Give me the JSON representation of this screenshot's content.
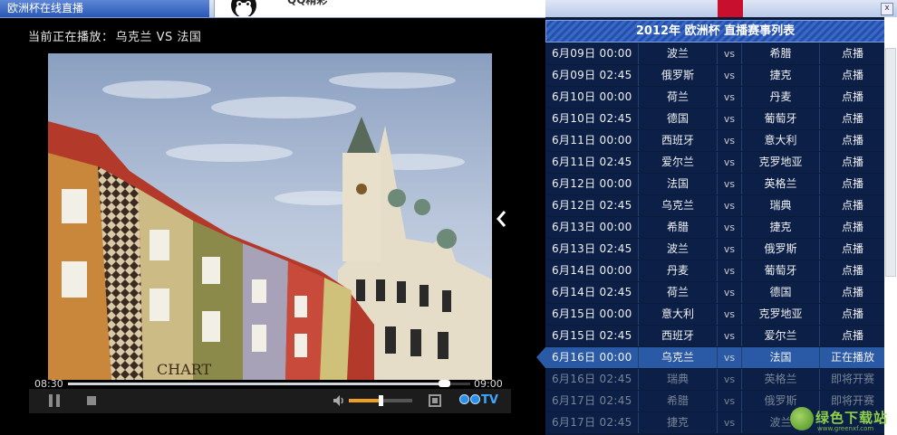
{
  "window": {
    "tab_title": "欧洲杯在线直播",
    "qq_label": "QQ精彩",
    "close_glyph": "x"
  },
  "player": {
    "now_playing_label": "当前正在播放：",
    "now_playing_match": "乌克兰 VS 法国",
    "current_time": "08:30",
    "total_time": "09:00",
    "progress_fraction": 0.935,
    "volume_fraction": 0.5,
    "logo_text": "TV"
  },
  "schedule": {
    "title": "2012年 欧洲杯 直播赛事列表",
    "vs_label": "vs",
    "rows": [
      {
        "date": "6月09日 00:00",
        "home": "波兰",
        "away": "希腊",
        "action": "点播",
        "state": "past"
      },
      {
        "date": "6月09日 02:45",
        "home": "俄罗斯",
        "away": "捷克",
        "action": "点播",
        "state": "past"
      },
      {
        "date": "6月10日 00:00",
        "home": "荷兰",
        "away": "丹麦",
        "action": "点播",
        "state": "past"
      },
      {
        "date": "6月10日 02:45",
        "home": "德国",
        "away": "葡萄牙",
        "action": "点播",
        "state": "past"
      },
      {
        "date": "6月11日 00:00",
        "home": "西班牙",
        "away": "意大利",
        "action": "点播",
        "state": "past"
      },
      {
        "date": "6月11日 02:45",
        "home": "爱尔兰",
        "away": "克罗地亚",
        "action": "点播",
        "state": "past"
      },
      {
        "date": "6月12日 00:00",
        "home": "法国",
        "away": "英格兰",
        "action": "点播",
        "state": "past"
      },
      {
        "date": "6月12日 02:45",
        "home": "乌克兰",
        "away": "瑞典",
        "action": "点播",
        "state": "past"
      },
      {
        "date": "6月13日 00:00",
        "home": "希腊",
        "away": "捷克",
        "action": "点播",
        "state": "past"
      },
      {
        "date": "6月13日 02:45",
        "home": "波兰",
        "away": "俄罗斯",
        "action": "点播",
        "state": "past"
      },
      {
        "date": "6月14日 00:00",
        "home": "丹麦",
        "away": "葡萄牙",
        "action": "点播",
        "state": "past"
      },
      {
        "date": "6月14日 02:45",
        "home": "荷兰",
        "away": "德国",
        "action": "点播",
        "state": "past"
      },
      {
        "date": "6月15日 00:00",
        "home": "意大利",
        "away": "克罗地亚",
        "action": "点播",
        "state": "past"
      },
      {
        "date": "6月15日 02:45",
        "home": "西班牙",
        "away": "爱尔兰",
        "action": "点播",
        "state": "past"
      },
      {
        "date": "6月16日 00:00",
        "home": "乌克兰",
        "away": "法国",
        "action": "正在播放",
        "state": "active"
      },
      {
        "date": "6月16日 02:45",
        "home": "瑞典",
        "away": "英格兰",
        "action": "即将开赛",
        "state": "upcoming"
      },
      {
        "date": "6月17日 02:45",
        "home": "希腊",
        "away": "俄罗斯",
        "action": "即将开赛",
        "state": "upcoming"
      },
      {
        "date": "6月17日 02:45",
        "home": "捷克",
        "away": "波兰",
        "action": "",
        "state": "upcoming"
      }
    ]
  },
  "watermark": {
    "text": "绿色下载站",
    "url": "www.greenxf.com"
  },
  "colors": {
    "table_bg": "#0b1f47",
    "active_row": "#2a5aa6",
    "volume_fill": "#f0a020"
  }
}
